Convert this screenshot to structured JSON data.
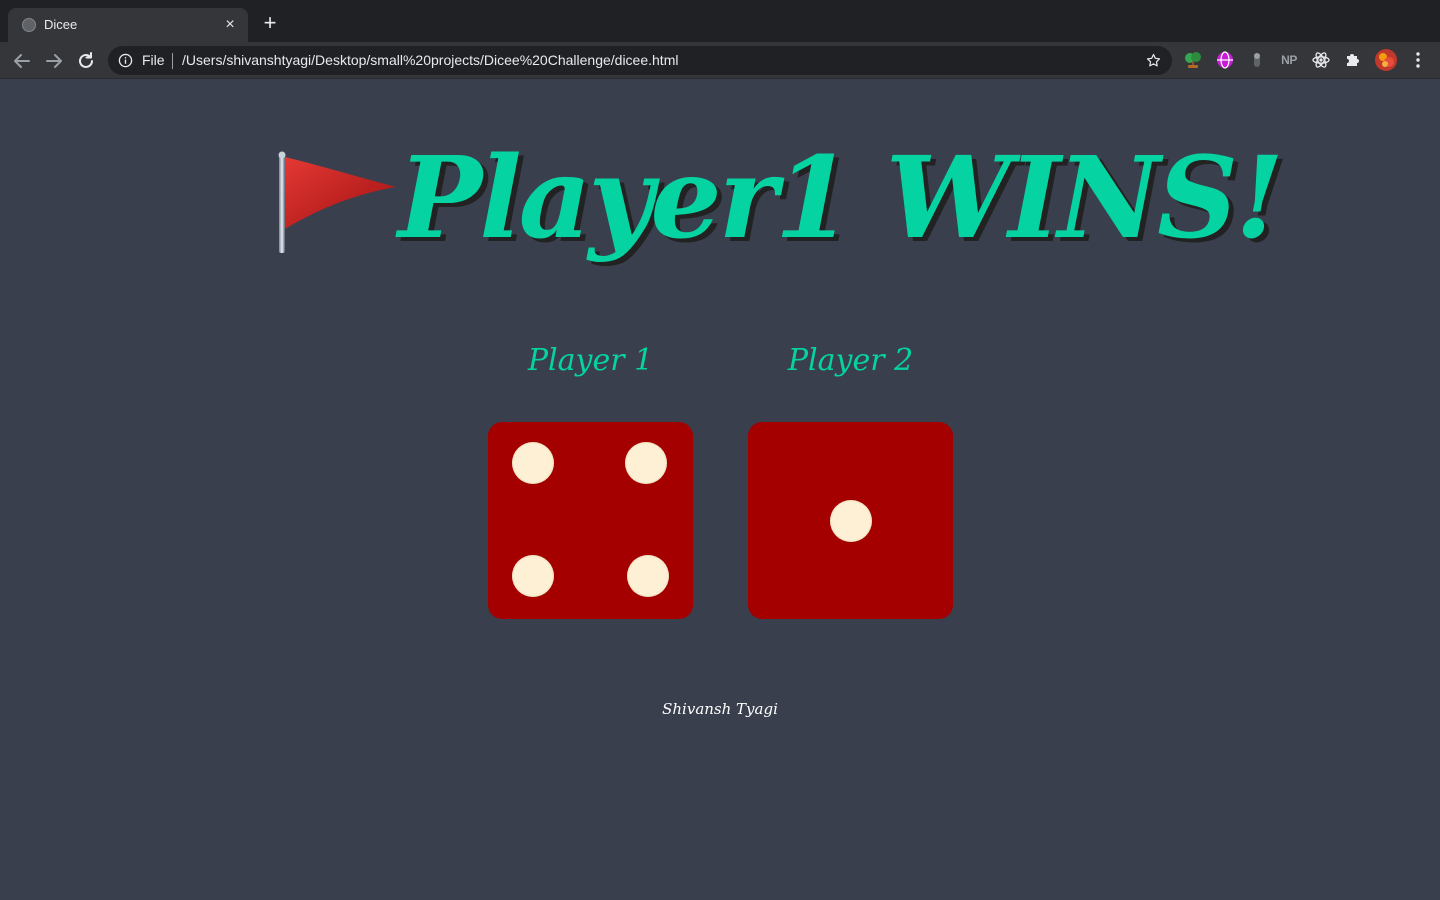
{
  "browser": {
    "tab_title": "Dicee",
    "tab_close": "×",
    "new_tab": "+",
    "scheme_label": "File",
    "url": "/Users/shivanshtyagi/Desktop/small%20projects/Dicee%20Challenge/dicee.html",
    "extensions": [
      "bonsai-icon",
      "globe-icon",
      "capsule-icon",
      "NP",
      "react-icon",
      "puzzle-icon",
      "avatar"
    ],
    "extension_np_label": "NP"
  },
  "page": {
    "headline": "Player1 WINS!",
    "flag_icon": "red-triangular-flag-icon",
    "players": [
      {
        "label": "Player 1",
        "die_value": 4
      },
      {
        "label": "Player 2",
        "die_value": 1
      }
    ],
    "credit": "Shivansh Tyagi"
  },
  "colors": {
    "background": "#393f4d",
    "accent": "#05d3a2",
    "die": "#a40000",
    "pip": "#fdf0d5"
  }
}
